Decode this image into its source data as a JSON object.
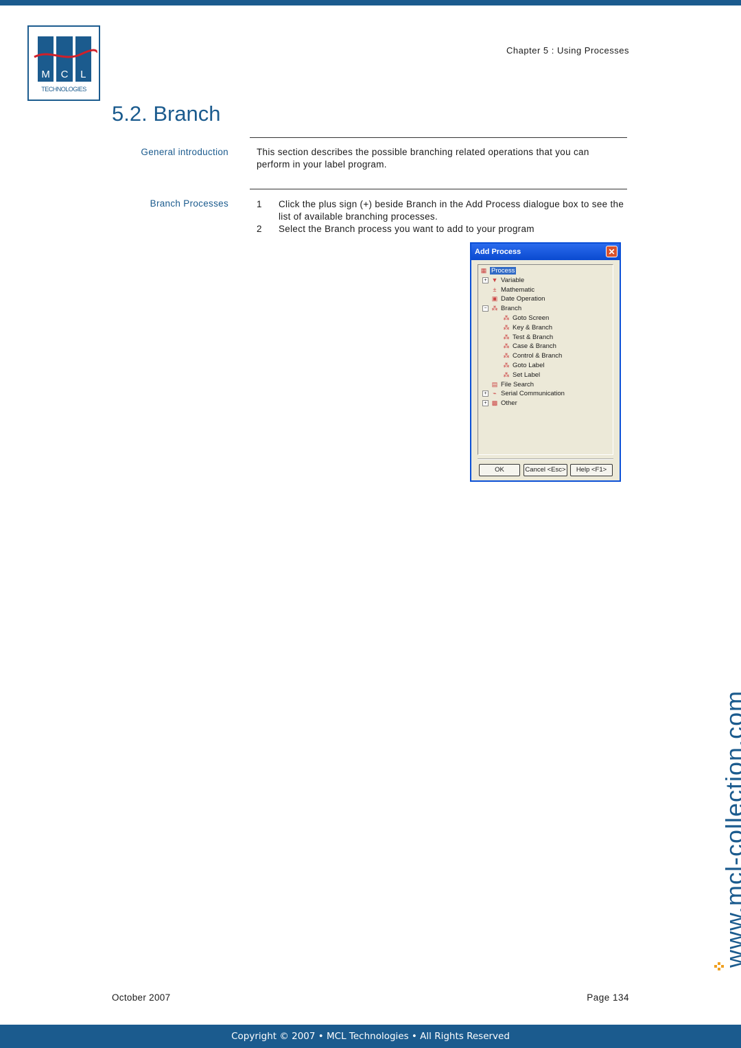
{
  "header": {
    "logo_letters": [
      "M",
      "C",
      "L"
    ],
    "logo_subtitle": "TECHNOLOGIES",
    "chapter": "Chapter 5 : Using Processes"
  },
  "section": {
    "title": "5.2. Branch",
    "general": {
      "heading": "General introduction",
      "text": "This section describes the possible branching related operations that you can perform in your label program."
    },
    "branch_processes": {
      "heading": "Branch Processes",
      "steps": [
        {
          "num": "1",
          "text": "Click the plus sign (+) beside Branch in the Add Process dialogue box to see the list of available branching processes."
        },
        {
          "num": "2",
          "text": "Select the Branch process you want to add to your program"
        }
      ]
    }
  },
  "dialog": {
    "title": "Add Process",
    "close_glyph": "✕",
    "tree": [
      {
        "label": "Process",
        "level": 0,
        "expander": "",
        "icon": "process-icon",
        "selected": true
      },
      {
        "label": "Variable",
        "level": 1,
        "expander": "+",
        "icon": "variable-icon"
      },
      {
        "label": "Mathematic",
        "level": 1,
        "expander": "",
        "icon": "mathematic-icon"
      },
      {
        "label": "Date Operation",
        "level": 1,
        "expander": "",
        "icon": "date-icon"
      },
      {
        "label": "Branch",
        "level": 1,
        "expander": "−",
        "icon": "branch-icon"
      },
      {
        "label": "Goto Screen",
        "level": 2,
        "expander": "",
        "icon": "branch-icon"
      },
      {
        "label": "Key & Branch",
        "level": 2,
        "expander": "",
        "icon": "branch-icon"
      },
      {
        "label": "Test & Branch",
        "level": 2,
        "expander": "",
        "icon": "branch-icon"
      },
      {
        "label": "Case & Branch",
        "level": 2,
        "expander": "",
        "icon": "branch-icon"
      },
      {
        "label": "Control & Branch",
        "level": 2,
        "expander": "",
        "icon": "branch-icon"
      },
      {
        "label": "Goto Label",
        "level": 2,
        "expander": "",
        "icon": "branch-icon"
      },
      {
        "label": "Set Label",
        "level": 2,
        "expander": "",
        "icon": "branch-icon"
      },
      {
        "label": "File Search",
        "level": 1,
        "expander": "",
        "icon": "file-search-icon"
      },
      {
        "label": "Serial Communication",
        "level": 1,
        "expander": "+",
        "icon": "serial-icon"
      },
      {
        "label": "Other",
        "level": 1,
        "expander": "+",
        "icon": "other-icon"
      }
    ],
    "buttons": {
      "ok": "OK",
      "cancel": "Cancel <Esc>",
      "help": "Help <F1>"
    }
  },
  "watermark": "www.mcl-collection.com",
  "footer": {
    "date": "October 2007",
    "page": "Page 134",
    "copyright": "Copyright © 2007 • MCL Technologies • All Rights Reserved"
  },
  "colors": {
    "brand": "#1b5b8e",
    "accent": "#f0a020"
  }
}
